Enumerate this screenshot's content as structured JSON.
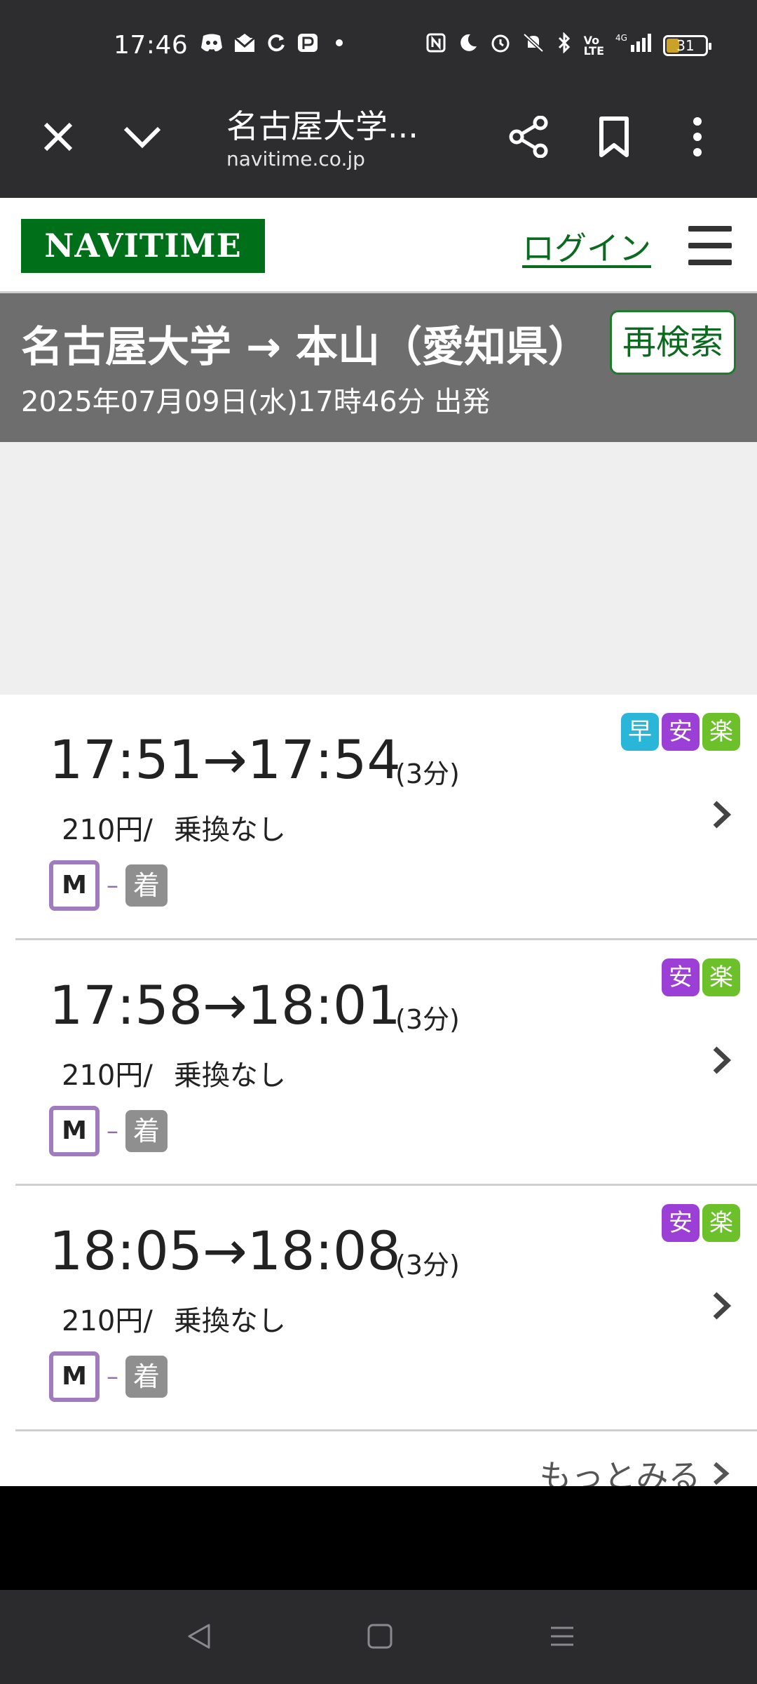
{
  "status_bar": {
    "time": "17:46",
    "battery_level": "31",
    "left_icons": [
      "discord-icon",
      "mail-icon",
      "sync-icon",
      "paypay-icon",
      "dot-icon"
    ],
    "right_icons": [
      "nfc-icon",
      "moon-icon",
      "alarm-icon",
      "mute-icon",
      "bluetooth-icon",
      "volte-icon",
      "signal-4g-icon",
      "battery-icon"
    ]
  },
  "browser": {
    "title": "名古屋大学...",
    "url": "navitime.co.jp"
  },
  "site": {
    "logo": "NAVITIME",
    "login": "ログイン"
  },
  "search": {
    "title": "名古屋大学 → 本山（愛知県）",
    "datetime": "2025年07月09日(水)17時46分 出発",
    "research_button": "再検索"
  },
  "routes": [
    {
      "times": "17:51→17:54",
      "duration": "(3分)",
      "fare": "210円/",
      "transfer": "乗換なし",
      "line_badge": "M",
      "dash": "–",
      "arrival_badge": "着",
      "tags": [
        {
          "label": "早",
          "color": "#29b6d8"
        },
        {
          "label": "安",
          "color": "#9b3fd6"
        },
        {
          "label": "楽",
          "color": "#6cc02a"
        }
      ]
    },
    {
      "times": "17:58→18:01",
      "duration": "(3分)",
      "fare": "210円/",
      "transfer": "乗換なし",
      "line_badge": "M",
      "dash": "–",
      "arrival_badge": "着",
      "tags": [
        {
          "label": "安",
          "color": "#9b3fd6"
        },
        {
          "label": "楽",
          "color": "#6cc02a"
        }
      ]
    },
    {
      "times": "18:05→18:08",
      "duration": "(3分)",
      "fare": "210円/",
      "transfer": "乗換なし",
      "line_badge": "M",
      "dash": "–",
      "arrival_badge": "着",
      "tags": [
        {
          "label": "安",
          "color": "#9b3fd6"
        },
        {
          "label": "楽",
          "color": "#6cc02a"
        }
      ]
    }
  ],
  "more_link": "もっとみる",
  "colors": {
    "navitime_green": "#006f1a",
    "header_gray": "#6e6e6e",
    "meijo_line_purple": "#a07cbf"
  }
}
